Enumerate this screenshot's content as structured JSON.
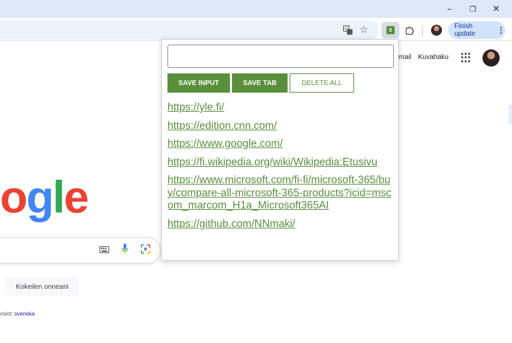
{
  "browser": {
    "window_controls": {
      "minimize": "–",
      "restore": "❐",
      "close": "✕"
    },
    "toolbar": {
      "translate_icon": "translate-icon",
      "bookmark_icon": "star-icon",
      "extension_badge": "S",
      "finish_update_label": "Finish update",
      "menu_icon": "⋮"
    }
  },
  "google": {
    "header_links": [
      "mail",
      "Kuvahaku"
    ],
    "logo_letters": [
      {
        "char": "o",
        "color": "#ea4335"
      },
      {
        "char": "g",
        "color": "#4285f4"
      },
      {
        "char": "l",
        "color": "#34a853"
      },
      {
        "char": "e",
        "color": "#ea4335"
      }
    ],
    "lucky_button": "Kokeilen onneani",
    "language_prefix": "ersiot:",
    "language_link": "svenska"
  },
  "popup": {
    "input_value": "",
    "buttons": {
      "save_input": "SAVE INPUT",
      "save_tab": "SAVE TAB",
      "delete_all": "DELETE ALL"
    },
    "links": [
      "https://yle.fi/",
      "https://edition.cnn.com/",
      "https://www.google.com/",
      "https://fi.wikipedia.org/wiki/Wikipedia:Etusivu",
      "https://www.microsoft.com/fi-fi/microsoft-365/buy/compare-all-microsoft-365-products?icid=mscom_marcom_H1a_Microsoft365AI",
      "https://github.com/NNmaki/"
    ],
    "accent_color": "#5a8f3c"
  }
}
